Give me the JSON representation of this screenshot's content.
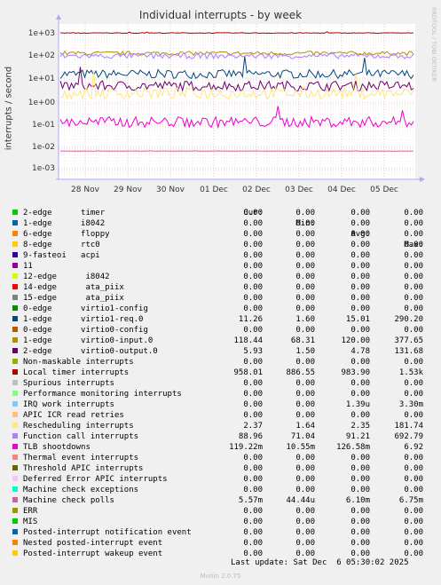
{
  "chart_data": {
    "type": "line",
    "title": "Individual interrupts - by week",
    "ylabel": "interrupts / second",
    "yscale": "log",
    "ylim": [
      0.0004,
      2000
    ],
    "y_ticks": [
      "1e-03",
      "1e-02",
      "1e-01",
      "1e+00",
      "1e+01",
      "1e+02",
      "1e+03"
    ],
    "x_ticks": [
      "28 Nov",
      "29 Nov",
      "30 Nov",
      "01 Dec",
      "02 Dec",
      "03 Dec",
      "04 Dec",
      "05 Dec"
    ],
    "grid": true,
    "legend_placement": "bottom",
    "columns": [
      "Cur:",
      "Min:",
      "Avg:",
      "Max:"
    ],
    "series": [
      {
        "name": "2-edge      timer",
        "color": "#00cc00",
        "cur": "0.00",
        "min": "0.00",
        "avg": "0.00",
        "max": "0.00"
      },
      {
        "name": "1-edge      i8042",
        "color": "#0066b3",
        "cur": "0.00",
        "min": "0.00",
        "avg": "0.00",
        "max": "0.00"
      },
      {
        "name": "6-edge      floppy",
        "color": "#ff8000",
        "cur": "0.00",
        "min": "0.00",
        "avg": "0.00",
        "max": "0.00"
      },
      {
        "name": "8-edge      rtc0",
        "color": "#ffcc00",
        "cur": "0.00",
        "min": "0.00",
        "avg": "0.00",
        "max": "0.00"
      },
      {
        "name": "9-fasteoi   acpi",
        "color": "#330099",
        "cur": "0.00",
        "min": "0.00",
        "avg": "0.00",
        "max": "0.00"
      },
      {
        "name": "11",
        "color": "#990099",
        "cur": "0.00",
        "min": "0.00",
        "avg": "0.00",
        "max": "0.00"
      },
      {
        "name": "12-edge      i8042",
        "color": "#ccff00",
        "cur": "0.00",
        "min": "0.00",
        "avg": "0.00",
        "max": "0.00"
      },
      {
        "name": "14-edge      ata_piix",
        "color": "#ff0000",
        "cur": "0.00",
        "min": "0.00",
        "avg": "0.00",
        "max": "0.00"
      },
      {
        "name": "15-edge      ata_piix",
        "color": "#808080",
        "cur": "0.00",
        "min": "0.00",
        "avg": "0.00",
        "max": "0.00"
      },
      {
        "name": "0-edge      virtio1-config",
        "color": "#008f00",
        "cur": "0.00",
        "min": "0.00",
        "avg": "0.00",
        "max": "0.00"
      },
      {
        "name": "1-edge      virtio1-req.0",
        "color": "#00487d",
        "cur": "11.26",
        "min": "1.60",
        "avg": "15.01",
        "max": "290.20"
      },
      {
        "name": "0-edge      virtio0-config",
        "color": "#b35a00",
        "cur": "0.00",
        "min": "0.00",
        "avg": "0.00",
        "max": "0.00"
      },
      {
        "name": "1-edge      virtio0-input.0",
        "color": "#b38f00",
        "cur": "118.44",
        "min": "68.31",
        "avg": "120.00",
        "max": "377.65"
      },
      {
        "name": "2-edge      virtio0-output.0",
        "color": "#6b006b",
        "cur": "5.93",
        "min": "1.50",
        "avg": "4.78",
        "max": "131.68"
      },
      {
        "name": "Non-maskable interrupts",
        "color": "#8fb300",
        "cur": "0.00",
        "min": "0.00",
        "avg": "0.00",
        "max": "0.00"
      },
      {
        "name": "Local timer interrupts",
        "color": "#b30000",
        "cur": "958.01",
        "min": "886.55",
        "avg": "983.90",
        "max": "1.53k"
      },
      {
        "name": "Spurious interrupts",
        "color": "#bebebe",
        "cur": "0.00",
        "min": "0.00",
        "avg": "0.00",
        "max": "0.00"
      },
      {
        "name": "Performance monitoring interrupts",
        "color": "#80ff80",
        "cur": "0.00",
        "min": "0.00",
        "avg": "0.00",
        "max": "0.00"
      },
      {
        "name": "IRQ work interrupts",
        "color": "#80c9ff",
        "cur": "0.00",
        "min": "0.00",
        "avg": "1.39u",
        "max": "3.30m"
      },
      {
        "name": "APIC ICR read retries",
        "color": "#ffc080",
        "cur": "0.00",
        "min": "0.00",
        "avg": "0.00",
        "max": "0.00"
      },
      {
        "name": "Rescheduling interrupts",
        "color": "#ffe680",
        "cur": "2.37",
        "min": "1.64",
        "avg": "2.35",
        "max": "181.74"
      },
      {
        "name": "Function call interrupts",
        "color": "#aa80ff",
        "cur": "88.96",
        "min": "71.04",
        "avg": "91.21",
        "max": "692.79"
      },
      {
        "name": "TLB shootdowns",
        "color": "#ee00cc",
        "cur": "119.22m",
        "min": "10.55m",
        "avg": "126.58m",
        "max": "6.92"
      },
      {
        "name": "Thermal event interrupts",
        "color": "#ff8080",
        "cur": "0.00",
        "min": "0.00",
        "avg": "0.00",
        "max": "0.00"
      },
      {
        "name": "Threshold APIC interrupts",
        "color": "#666600",
        "cur": "0.00",
        "min": "0.00",
        "avg": "0.00",
        "max": "0.00"
      },
      {
        "name": "Deferred Error APIC interrupts",
        "color": "#ffbfff",
        "cur": "0.00",
        "min": "0.00",
        "avg": "0.00",
        "max": "0.00"
      },
      {
        "name": "Machine check exceptions",
        "color": "#00ffcc",
        "cur": "0.00",
        "min": "0.00",
        "avg": "0.00",
        "max": "0.00"
      },
      {
        "name": "Machine check polls",
        "color": "#cc6699",
        "cur": "5.57m",
        "min": "44.44u",
        "avg": "6.10m",
        "max": "6.75m"
      },
      {
        "name": "ERR",
        "color": "#999900",
        "cur": "0.00",
        "min": "0.00",
        "avg": "0.00",
        "max": "0.00"
      },
      {
        "name": "MIS",
        "color": "#00cc00",
        "cur": "0.00",
        "min": "0.00",
        "avg": "0.00",
        "max": "0.00"
      },
      {
        "name": "Posted-interrupt notification event",
        "color": "#0066b3",
        "cur": "0.00",
        "min": "0.00",
        "avg": "0.00",
        "max": "0.00"
      },
      {
        "name": "Nested posted-interrupt event",
        "color": "#ff8000",
        "cur": "0.00",
        "min": "0.00",
        "avg": "0.00",
        "max": "0.00"
      },
      {
        "name": "Posted-interrupt wakeup event",
        "color": "#ffcc00",
        "cur": "0.00",
        "min": "0.00",
        "avg": "0.00",
        "max": "0.00"
      }
    ]
  },
  "footer": {
    "last_update": "Last update: Sat Dec  6 05:30:02 2025",
    "munin": "Munin 2.0.75",
    "rrdtool": "RRDTOOL / TOBI OETIKER"
  }
}
